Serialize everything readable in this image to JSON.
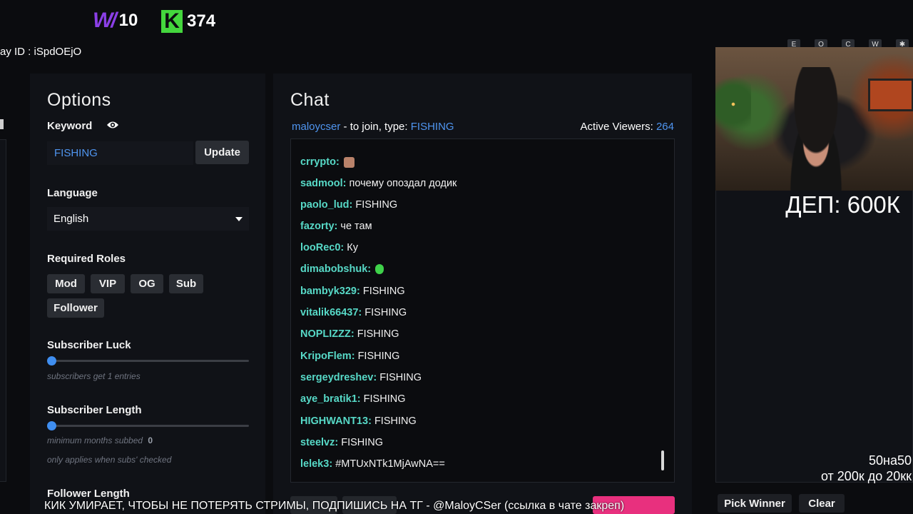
{
  "counters": [
    {
      "logo": "W",
      "value": "10",
      "color": "#8b3fe6"
    },
    {
      "logo": "K",
      "value": "374",
      "color": "#44d63d"
    }
  ],
  "giveaway_id": "ay ID :  iSpdOEjO",
  "options": {
    "title": "Options",
    "keyword_label": "Keyword",
    "keyword_value": "FISHING",
    "update_label": "Update",
    "language_label": "Language",
    "language_value": "English",
    "required_roles_label": "Required Roles",
    "roles": [
      "Mod",
      "VIP",
      "OG",
      "Sub",
      "Follower"
    ],
    "subscriber_luck_label": "Subscriber Luck",
    "subscriber_luck_hint": "subscribers get 1 entries",
    "subscriber_length_label": "Subscriber Length",
    "subscriber_length_hint": "minimum months subbed",
    "subscriber_length_value": "0",
    "subscriber_length_note": "only applies when subs' checked",
    "follower_length_label": "Follower Length",
    "slider_level": 0
  },
  "chat": {
    "title": "Chat",
    "channel": "maloycser",
    "join_text": " - to join, type: ",
    "keyword": "FISHING",
    "active_viewers_label": "Active Viewers:",
    "active_viewers": "264",
    "messages": [
      {
        "user": "crrypto:",
        "text": "",
        "emote": "face"
      },
      {
        "user": "sadmool:",
        "text": "почему опоздал додик"
      },
      {
        "user": "paolo_lud:",
        "text": "FISHING"
      },
      {
        "user": "fazorty:",
        "text": "че там"
      },
      {
        "user": "looRec0:",
        "text": "Ку"
      },
      {
        "user": "dimabobshuk:",
        "text": "",
        "emote": "green"
      },
      {
        "user": "bambyk329:",
        "text": "FISHING"
      },
      {
        "user": "vitalik66437:",
        "text": "FISHING"
      },
      {
        "user": "NOPLIZZZ:",
        "text": "FISHING"
      },
      {
        "user": "KripoFlem:",
        "text": "FISHING"
      },
      {
        "user": "sergeydreshev:",
        "text": "FISHING"
      },
      {
        "user": "aye_bratik1:",
        "text": "FISHING"
      },
      {
        "user": "HIGHWANT13:",
        "text": "FISHING"
      },
      {
        "user": "steelvz:",
        "text": "FISHING"
      },
      {
        "user": "lelek3:",
        "text": "#MTUxNTk1MjAwNA=="
      }
    ]
  },
  "winner": {
    "pick_label": "Pick Winner",
    "clear_label": "Clear"
  },
  "keys": [
    "E",
    "O",
    "C",
    "W",
    "✱"
  ],
  "overlay": {
    "dep": "ДЕП: 600К",
    "line1": "50на50",
    "line2": "от 200к до 20кк",
    "ticker": "КИК УМИРАЕТ, ЧТОБЫ НЕ ПОТЕРЯТЬ СТРИМЫ, ПОДПИШИСЬ НА ТГ - @MaloyCSer (ссылка в чате закреп)"
  },
  "colors": {
    "accent_blue": "#4f95f0",
    "username_teal": "#57d9c7",
    "pink_button": "#e8307e"
  }
}
